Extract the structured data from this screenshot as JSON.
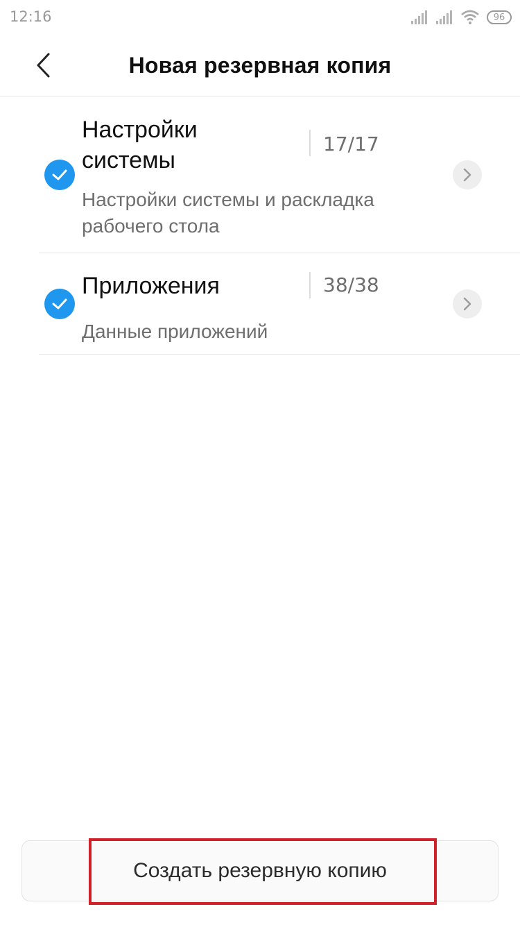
{
  "status_bar": {
    "time": "12:16",
    "battery": "96",
    "icons": [
      "signal-icon",
      "signal-icon",
      "wifi-icon",
      "battery-icon"
    ]
  },
  "header": {
    "title": "Новая резервная копия",
    "back_icon": "chevron-left-icon"
  },
  "items": [
    {
      "title": "Настройки системы",
      "count": "17/17",
      "subtitle": "Настройки системы и раскладка рабочего стола",
      "checked": true
    },
    {
      "title": "Приложения",
      "count": "38/38",
      "subtitle": "Данные приложений",
      "checked": true
    }
  ],
  "actions": {
    "create_label": "Создать резервную копию"
  },
  "colors": {
    "accent": "#1f97ee",
    "highlight": "#d0202a"
  }
}
